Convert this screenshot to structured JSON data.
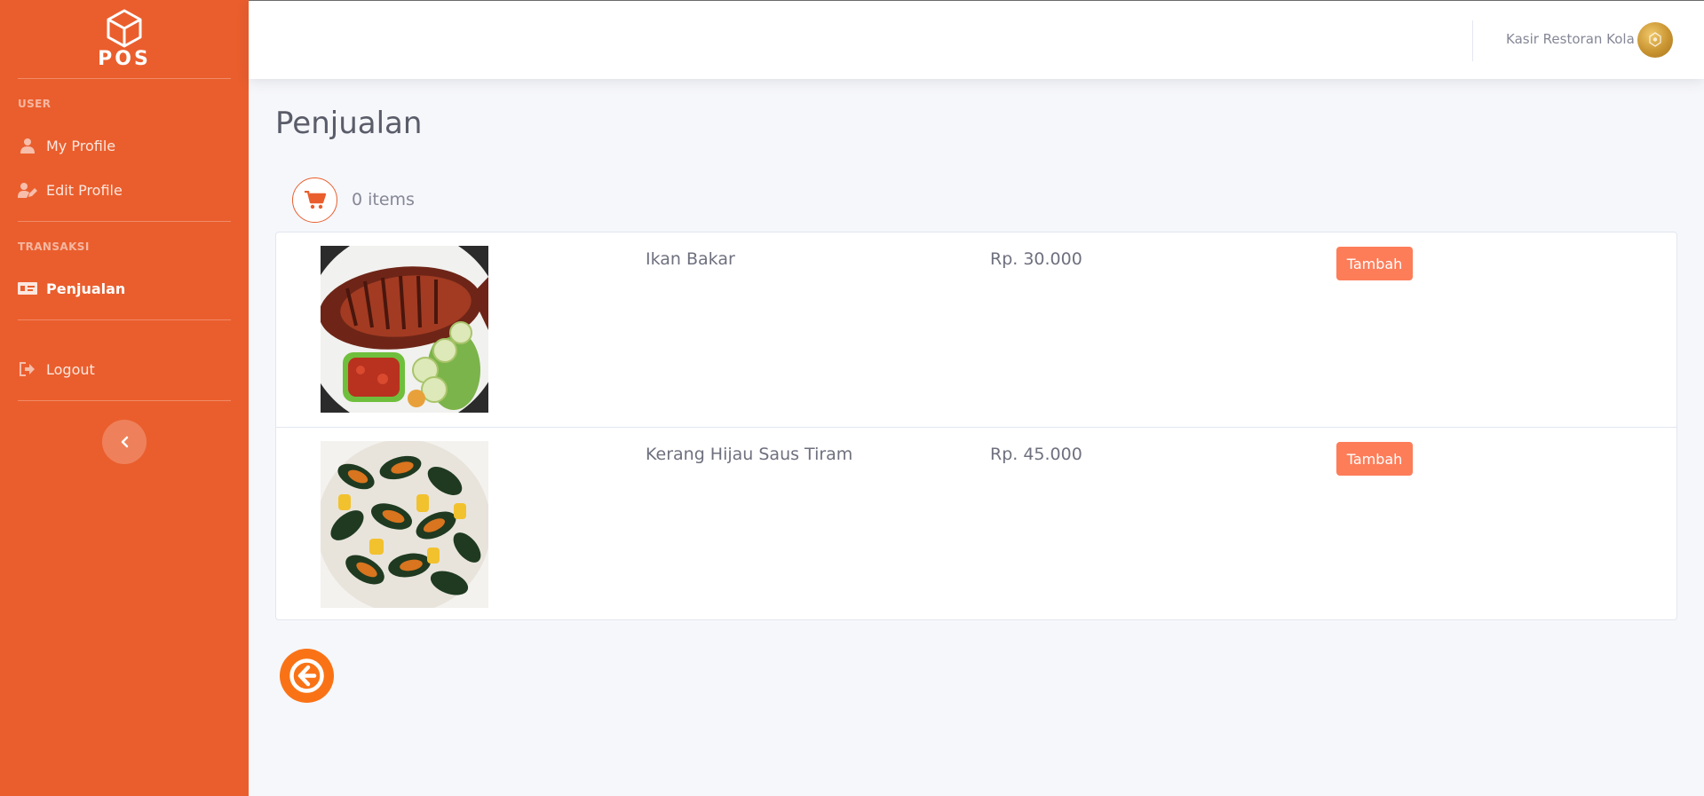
{
  "brand": {
    "logo_text": "POS",
    "icon": "cube-icon"
  },
  "sidebar": {
    "sections": [
      {
        "heading": "USER"
      },
      {
        "heading": "TRANSAKSI"
      }
    ],
    "items": [
      {
        "label": "My Profile",
        "icon": "user-icon"
      },
      {
        "label": "Edit Profile",
        "icon": "user-edit-icon"
      },
      {
        "label": "Penjualan",
        "icon": "money-bill-icon",
        "active": true
      },
      {
        "label": "Logout",
        "icon": "sign-out-icon"
      }
    ],
    "toggle_icon": "chevron-left-icon",
    "color": "#ea5e2d"
  },
  "topbar": {
    "user_name": "Kasir Restoran Kola",
    "avatar_icon": "avatar"
  },
  "main": {
    "title": "Penjualan",
    "cart": {
      "icon": "cart-icon",
      "count_label": "0 items"
    },
    "products": [
      {
        "name": "Ikan Bakar",
        "price": "Rp. 30.000",
        "button": "Tambah",
        "image": "grilled-fish-image"
      },
      {
        "name": "Kerang Hijau Saus Tiram",
        "price": "Rp. 45.000",
        "button": "Tambah",
        "image": "green-mussels-image"
      }
    ],
    "back_icon": "arrow-circle-left-icon"
  },
  "colors": {
    "accent": "#ea5e2d",
    "button": "#fd7d59",
    "back_button": "#f97316"
  }
}
